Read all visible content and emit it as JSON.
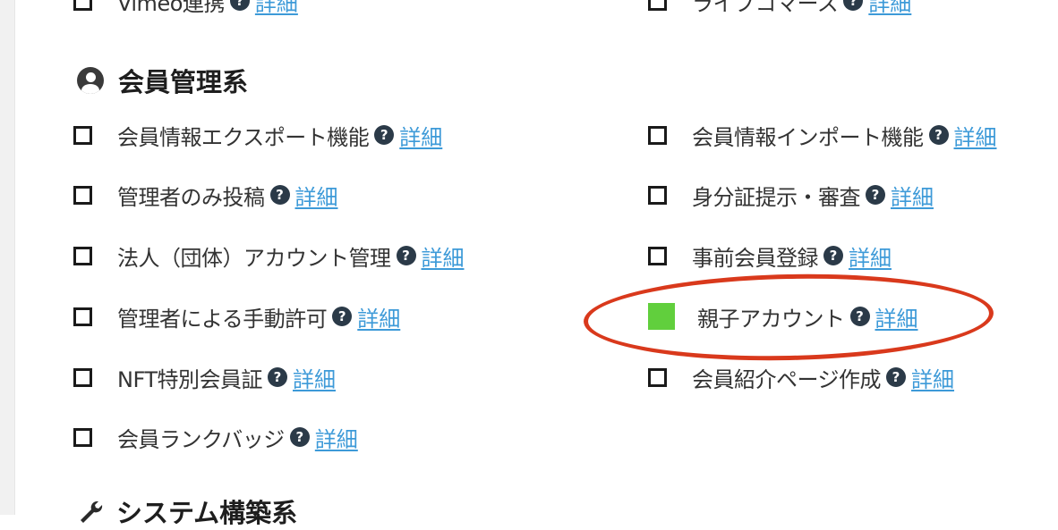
{
  "top_partial": {
    "left": {
      "label": "Vimeo連携",
      "link": "詳細"
    },
    "right": {
      "label": "ライブコマース",
      "link": "詳細"
    }
  },
  "member_section": {
    "title": "会員管理系",
    "icon": "user-circle-icon",
    "left_items": [
      {
        "label": "会員情報エクスポート機能",
        "link": "詳細",
        "checked": false
      },
      {
        "label": "管理者のみ投稿",
        "link": "詳細",
        "checked": false
      },
      {
        "label": "法人（団体）アカウント管理",
        "link": "詳細",
        "checked": false
      },
      {
        "label": "管理者による手動許可",
        "link": "詳細",
        "checked": false
      },
      {
        "label": "NFT特別会員証",
        "link": "詳細",
        "checked": false
      },
      {
        "label": "会員ランクバッジ",
        "link": "詳細",
        "checked": false
      }
    ],
    "right_items": [
      {
        "label": "会員情報インポート機能",
        "link": "詳細",
        "checked": false
      },
      {
        "label": "身分証提示・審査",
        "link": "詳細",
        "checked": false
      },
      {
        "label": "事前会員登録",
        "link": "詳細",
        "checked": false
      },
      {
        "label": "親子アカウント",
        "link": "詳細",
        "checked": true
      },
      {
        "label": "会員紹介ページ作成",
        "link": "詳細",
        "checked": false
      }
    ]
  },
  "system_section": {
    "title": "システム構築系",
    "icon": "wrench-icon"
  },
  "help_glyph": "?",
  "colors": {
    "checked_fill": "#61cf3d",
    "link": "#3d9ad8",
    "help_badge": "#2b3a48",
    "annotation": "#d9391c"
  }
}
